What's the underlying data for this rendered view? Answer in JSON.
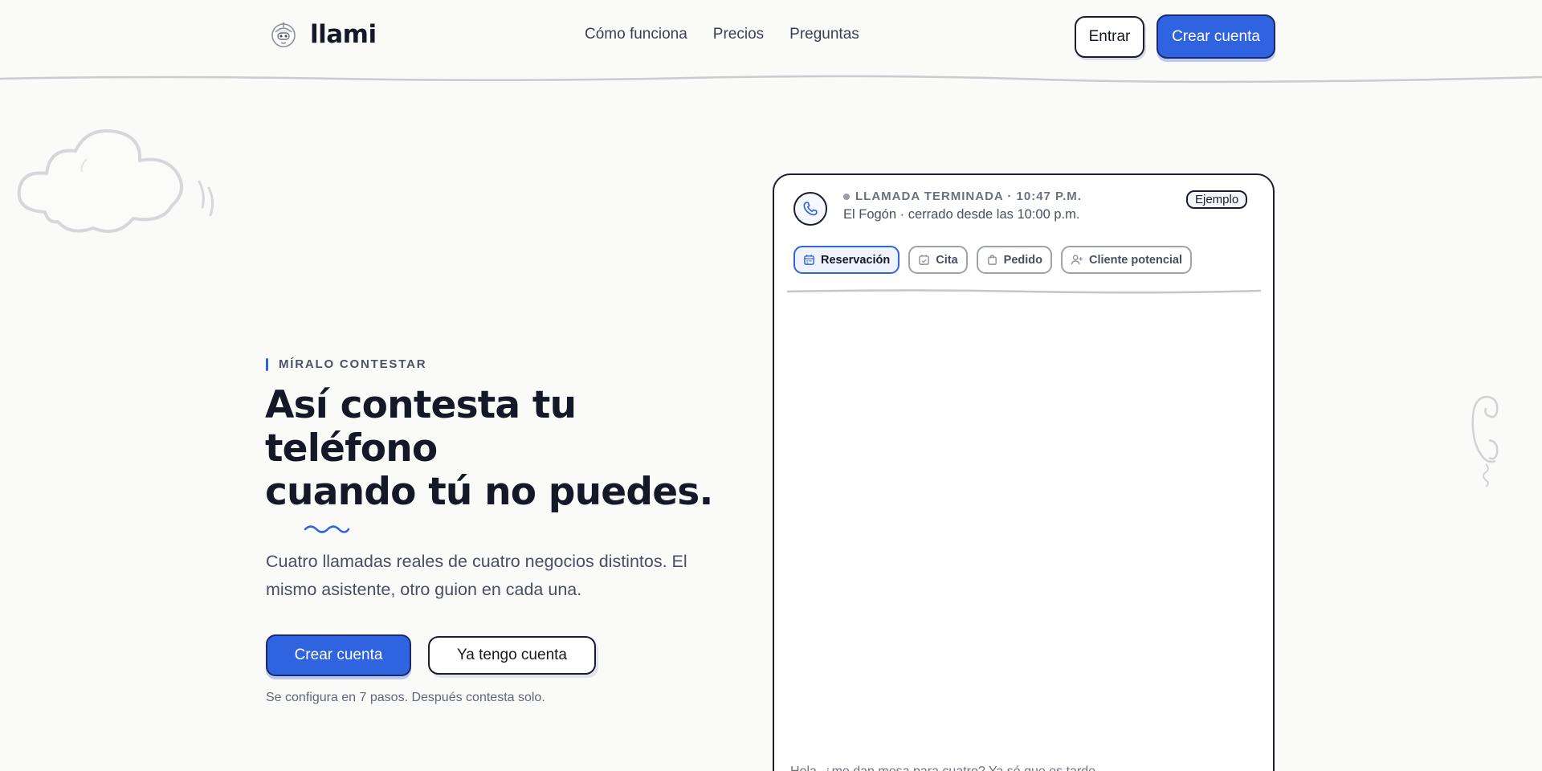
{
  "brand": {
    "name": "llami",
    "logo_icon": "robot-face-icon"
  },
  "nav": {
    "items": [
      "Cómo funciona",
      "Precios",
      "Preguntas"
    ]
  },
  "header": {
    "login_label": "Entrar",
    "signup_label": "Crear cuenta"
  },
  "hero": {
    "eyebrow": "MÍRALO CONTESTAR",
    "title_lines": [
      "Así contesta tu",
      "teléfono",
      "cuando tú no puedes."
    ],
    "description": "Cuatro llamadas reales de cuatro negocios distintos. El mismo asistente, otro guion en cada una.",
    "primary_cta": "Crear cuenta",
    "secondary_cta": "Ya tengo cuenta",
    "note": "Se configura en 7 pasos. Después contesta solo."
  },
  "call_card": {
    "status": "LLAMADA TERMINADA · 10:47 P.M.",
    "subtitle": "El Fogón · cerrado desde las 10:00 p.m.",
    "badge": "Ejemplo",
    "tabs": [
      {
        "label": "Reservación",
        "icon": "calendar-icon",
        "active": true
      },
      {
        "label": "Cita",
        "icon": "calendar-check-icon",
        "active": false
      },
      {
        "label": "Pedido",
        "icon": "shopping-bag-icon",
        "active": false
      },
      {
        "label": "Cliente potencial",
        "icon": "user-plus-icon",
        "active": false
      }
    ],
    "transcript_peek": "Hola, ¿me dan mesa para cuatro? Ya sé que es tarde…"
  },
  "colors": {
    "accent": "#2f63e0",
    "ink": "#141827",
    "background": "#fafaf8"
  }
}
